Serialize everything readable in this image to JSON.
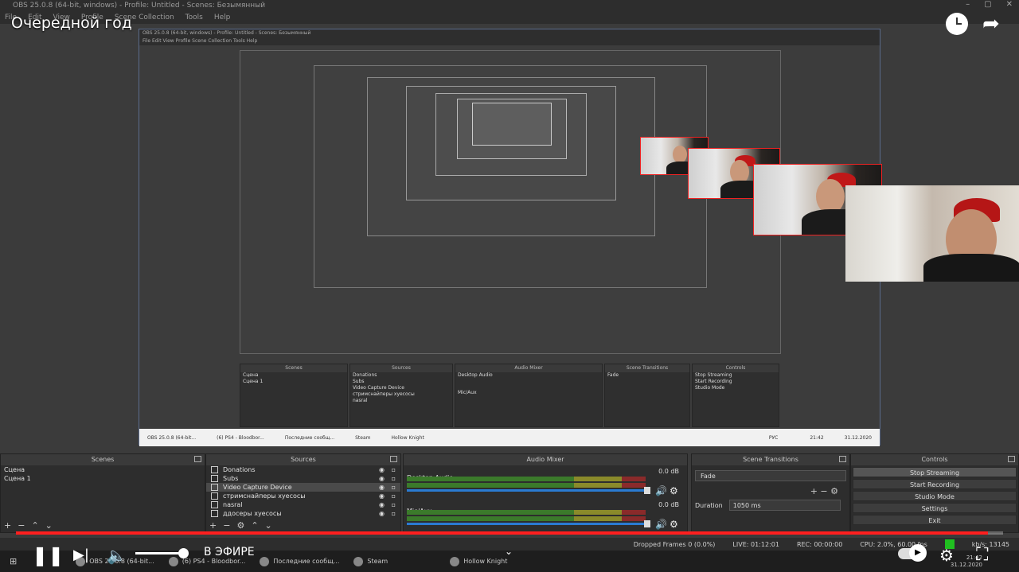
{
  "obs": {
    "window_title": "OBS 25.0.8 (64-bit, windows) - Profile: Untitled - Scenes: Безымянный",
    "menu": [
      "File",
      "Edit",
      "View",
      "Profile",
      "Scene Collection",
      "Tools",
      "Help"
    ],
    "panels": {
      "scenes": {
        "title": "Scenes",
        "items": [
          "Сцена",
          "Сцена 1"
        ]
      },
      "sources": {
        "title": "Sources",
        "items": [
          "Donations",
          "Subs",
          "Video Capture Device",
          "стримснайперы хуесосы",
          "nasral",
          "ддосеры хуесосы"
        ],
        "selected_index": 2
      },
      "audio_mixer": {
        "title": "Audio Mixer",
        "channels": [
          {
            "name": "Desktop Audio",
            "db": "0.0 dB"
          },
          {
            "name": "Mic/Aux",
            "db": "0.0 dB"
          }
        ]
      },
      "scene_transitions": {
        "title": "Scene Transitions",
        "transition": "Fade",
        "duration_label": "Duration",
        "duration_value": "1050 ms"
      },
      "controls": {
        "title": "Controls",
        "buttons": [
          "Stop Streaming",
          "Start Recording",
          "Studio Mode",
          "Settings",
          "Exit"
        ],
        "active_index": 0
      }
    },
    "status": {
      "dropped_frames": "Dropped Frames 0 (0.0%)",
      "live": "LIVE: 01:12:01",
      "rec": "REC: 00:00:00",
      "cpu": "CPU: 2.0%, 60.00 fps",
      "kbps": "kb/s: 13145"
    },
    "preview_inner": {
      "title": "OBS 25.0.8 (64-bit, windows) - Profile: Untitled - Scenes: Безымянный",
      "menu": "File  Edit  View  Profile  Scene Collection  Tools  Help",
      "taskbar_clock": "21:42",
      "taskbar_date": "31.12.2020",
      "taskbar_lang": "РУС"
    }
  },
  "video": {
    "title": "Очередной год",
    "live_label": "В ЭФИРЕ",
    "progress": 0.985
  },
  "taskbar": {
    "items": [
      "OBS 25.0.8 (64-bit...",
      "(6) PS4 - Bloodbor...",
      "Последние сообщ...",
      "Steam",
      "Hollow Knight"
    ],
    "clock": "21:42",
    "date": "31.12.2020"
  },
  "colors": {
    "accent_red": "#ff1f1f",
    "meter_green": "#3b7a2b",
    "fader_blue": "#2a7bd2",
    "live_green": "#20c020"
  }
}
